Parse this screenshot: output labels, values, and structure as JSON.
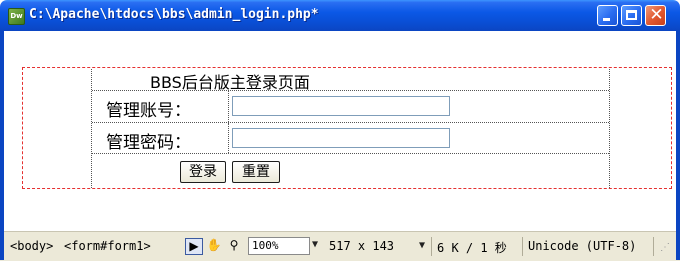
{
  "window": {
    "title": "C:\\Apache\\htdocs\\bbs\\admin_login.php*",
    "app_icon_text": "Dw"
  },
  "form": {
    "heading": "BBS后台版主登录页面",
    "username_label": "管理账号：",
    "password_label": "管理密码：",
    "submit_label": "登录",
    "reset_label": "重置"
  },
  "statusbar": {
    "tags": [
      "<body>",
      "<form#form1>"
    ],
    "zoom": "100%",
    "dimensions": "517 x 143",
    "filesize": "6 K / 1 秒",
    "encoding": "Unicode (UTF-8)"
  },
  "colors": {
    "titlebar": "#0b58e6",
    "form_border": "#e53030",
    "statusbar_bg": "#ece9d8"
  },
  "icons": [
    "app-icon",
    "minimize-icon",
    "maximize-icon",
    "close-icon",
    "pointer-tool-icon",
    "hand-tool-icon",
    "zoom-tool-icon",
    "resize-grip-icon"
  ]
}
